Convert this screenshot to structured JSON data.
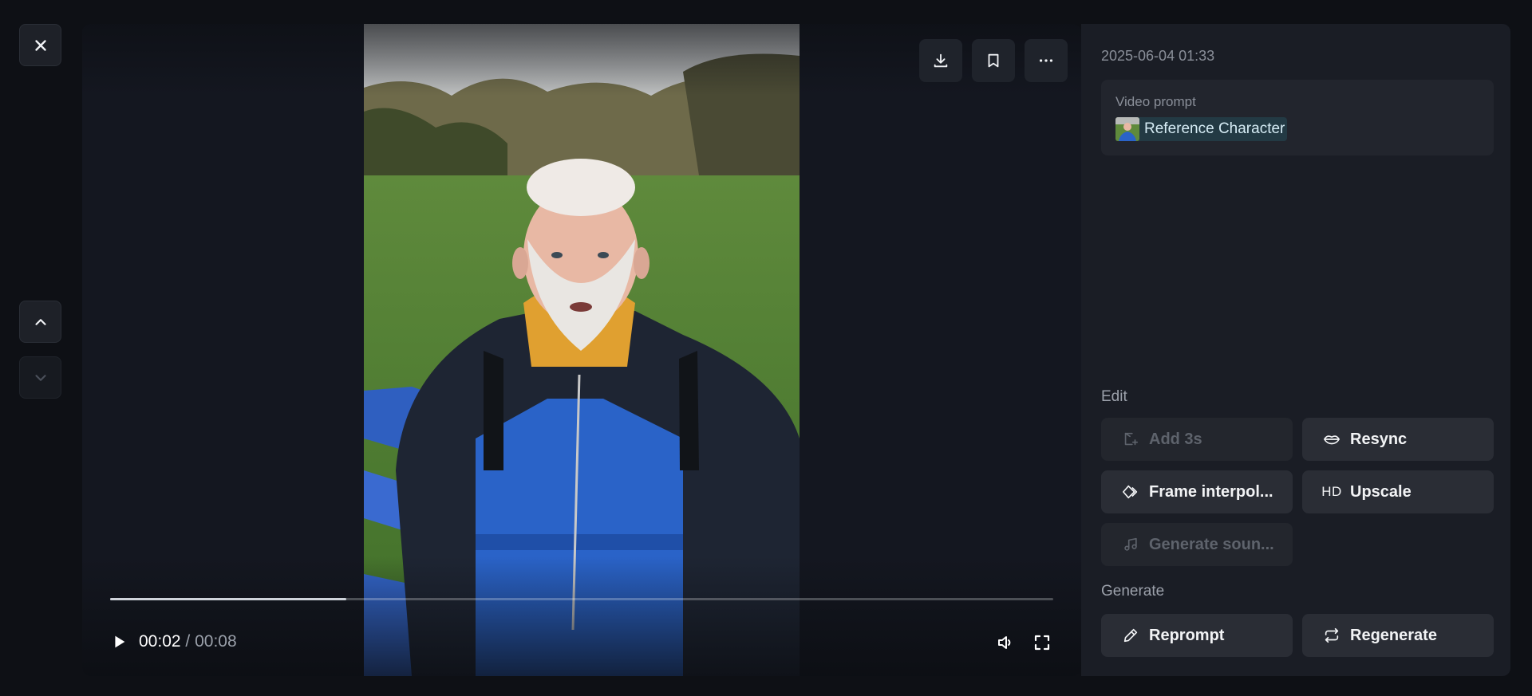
{
  "nav": {
    "close_icon": "close-icon",
    "prev_icon": "chevron-up-icon",
    "next_icon": "chevron-down-icon"
  },
  "player": {
    "toolbar": {
      "download_icon": "download-icon",
      "bookmark_icon": "bookmark-icon",
      "more_icon": "more-horizontal-icon"
    },
    "progress_fraction": 0.25,
    "current_time": "00:02",
    "separator": "/",
    "duration": "00:08",
    "volume_icon": "volume-icon",
    "fullscreen_icon": "fullscreen-icon"
  },
  "details": {
    "timestamp": "2025-06-04 01:33",
    "prompt_label": "Video prompt",
    "reference_chip": "Reference Character"
  },
  "edit": {
    "label": "Edit",
    "actions": [
      {
        "label": "Add 3s",
        "icon": "add-clip-icon",
        "disabled": true
      },
      {
        "label": "Resync",
        "icon": "lips-icon",
        "disabled": false
      },
      {
        "label": "Frame interpol...",
        "icon": "diamond-frames-icon",
        "disabled": false
      },
      {
        "label": "Upscale",
        "icon": "hd-icon",
        "icon_text": "HD",
        "disabled": false
      },
      {
        "label": "Generate soun...",
        "icon": "music-note-icon",
        "disabled": true
      }
    ]
  },
  "generate": {
    "label": "Generate",
    "actions": [
      {
        "label": "Reprompt",
        "icon": "pen-icon"
      },
      {
        "label": "Regenerate",
        "icon": "repeat-icon"
      }
    ]
  },
  "colors": {
    "background": "#0e1015",
    "panel": "#1a1d25",
    "button": "#2a2d35",
    "chip": "#233a44"
  }
}
